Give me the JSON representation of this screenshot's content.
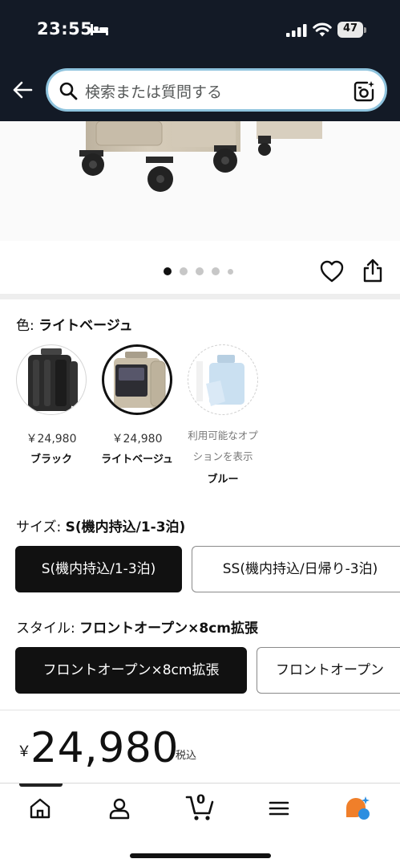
{
  "status_bar": {
    "time": "23:55",
    "battery_level": "47",
    "icons": [
      "bed-icon",
      "cellular-signal-icon",
      "wifi-icon",
      "battery-icon"
    ]
  },
  "header": {
    "search_placeholder": "検索または質問する",
    "icons": [
      "back-arrow-icon",
      "search-icon",
      "camera-icon"
    ]
  },
  "carousel": {
    "image_count": 5,
    "active_index": 0
  },
  "color_selector": {
    "label_prefix": "色:",
    "selected_value": "ライトベージュ",
    "options": [
      {
        "price": "￥24,980",
        "name": "ブラック",
        "selected": false,
        "available": true
      },
      {
        "price": "￥24,980",
        "name": "ライトベージュ",
        "selected": true,
        "available": true
      },
      {
        "availability_line1": "利用可能なオプ",
        "availability_line2": "ションを表示",
        "name": "ブルー",
        "selected": false,
        "available": false
      }
    ]
  },
  "size_selector": {
    "label_prefix": "サイズ:",
    "selected_value": "S(機内持込/1-3泊)",
    "options": [
      {
        "label": "S(機内持込/1-3泊)",
        "selected": true
      },
      {
        "label": "SS(機内持込/日帰り-3泊)",
        "selected": false
      }
    ]
  },
  "style_selector": {
    "label_prefix": "スタイル:",
    "selected_value": "フロントオープン×8cm拡張",
    "options": [
      {
        "label": "フロントオープン×8cm拡張",
        "selected": true
      },
      {
        "label": "フロントオープン",
        "selected": false
      }
    ]
  },
  "price": {
    "currency": "￥",
    "amount": "24,980",
    "tax_note": "税込"
  },
  "bottom_nav": {
    "items": [
      "home-icon",
      "account-icon",
      "cart-icon",
      "menu-icon",
      "rufus-ai-icon"
    ],
    "cart_count": "0",
    "active": "home-icon"
  },
  "colors": {
    "header_bg": "#131a26",
    "selected_button": "#111111",
    "accent_orange": "#f07f2a",
    "accent_blue": "#2d8ee0"
  }
}
